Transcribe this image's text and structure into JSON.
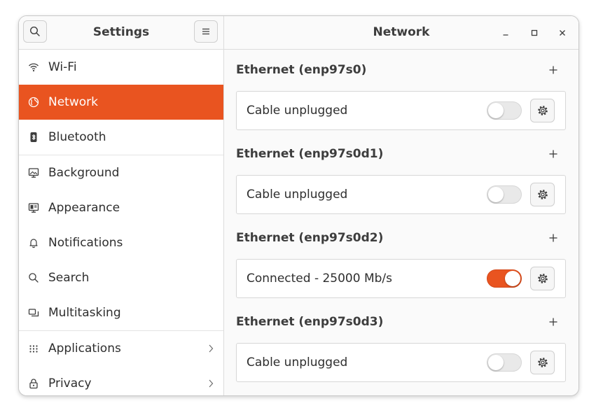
{
  "app": {
    "title": "Settings"
  },
  "sidebar": {
    "items": [
      {
        "label": "Wi-Fi",
        "icon": "wifi-icon"
      },
      {
        "label": "Network",
        "icon": "globe-icon",
        "active": true
      },
      {
        "label": "Bluetooth",
        "icon": "bluetooth-icon"
      },
      {
        "label": "Background",
        "icon": "monitor-icon"
      },
      {
        "label": "Appearance",
        "icon": "appearance-icon"
      },
      {
        "label": "Notifications",
        "icon": "bell-icon"
      },
      {
        "label": "Search",
        "icon": "search-icon"
      },
      {
        "label": "Multitasking",
        "icon": "windows-icon"
      },
      {
        "label": "Applications",
        "icon": "apps-grid-icon",
        "has_submenu": true
      },
      {
        "label": "Privacy",
        "icon": "lock-icon",
        "has_submenu": true
      }
    ]
  },
  "main": {
    "title": "Network",
    "sections": [
      {
        "title": "Ethernet (enp97s0)",
        "status": "Cable unplugged",
        "enabled": false
      },
      {
        "title": "Ethernet (enp97s0d1)",
        "status": "Cable unplugged",
        "enabled": false
      },
      {
        "title": "Ethernet (enp97s0d2)",
        "status": "Connected - 25000 Mb/s",
        "enabled": true
      },
      {
        "title": "Ethernet (enp97s0d3)",
        "status": "Cable unplugged",
        "enabled": false
      }
    ]
  },
  "colors": {
    "accent": "#e95420",
    "sidebar_bg": "#ffffff",
    "content_bg": "#fafafa"
  }
}
